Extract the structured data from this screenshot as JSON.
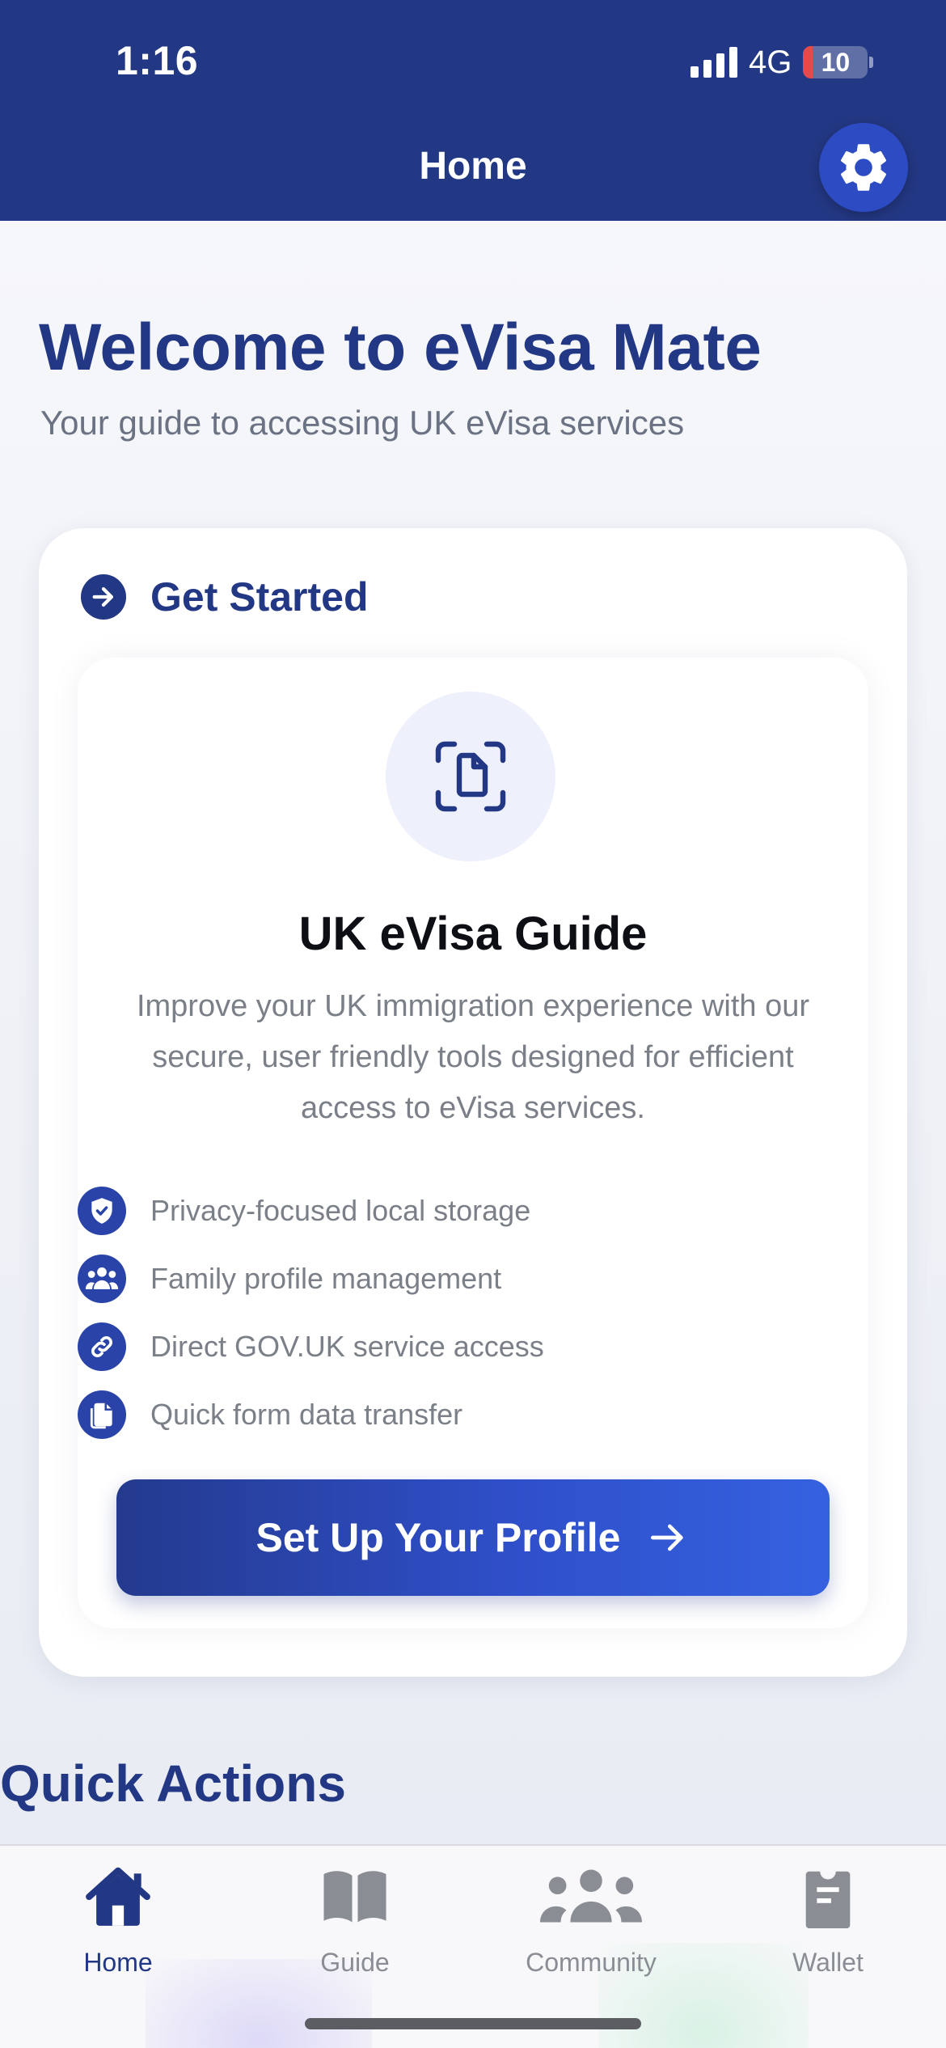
{
  "status_bar": {
    "time": "1:16",
    "network": "4G",
    "battery": "10"
  },
  "header": {
    "title": "Home",
    "settings_icon": "gear-icon"
  },
  "welcome": {
    "title": "Welcome to eVisa Mate",
    "subtitle": "Your guide to accessing UK eVisa services"
  },
  "get_started": {
    "label": "Get Started",
    "icon": "arrow-right-circle-icon",
    "card": {
      "icon": "document-scan-icon",
      "title": "UK eVisa Guide",
      "description": "Improve your UK immigration experience with our secure, user friendly tools designed for efficient access to eVisa services.",
      "features": [
        {
          "icon": "shield-check-icon",
          "label": "Privacy-focused local storage"
        },
        {
          "icon": "people-icon",
          "label": "Family profile management"
        },
        {
          "icon": "link-icon",
          "label": "Direct GOV.UK service access"
        },
        {
          "icon": "documents-icon",
          "label": "Quick form data transfer"
        }
      ],
      "cta_label": "Set Up Your Profile"
    }
  },
  "quick_actions": {
    "title": "Quick Actions"
  },
  "tabs": [
    {
      "label": "Home",
      "icon": "house-icon",
      "active": true
    },
    {
      "label": "Guide",
      "icon": "book-icon",
      "active": false
    },
    {
      "label": "Community",
      "icon": "people-icon",
      "active": false
    },
    {
      "label": "Wallet",
      "icon": "wallet-icon",
      "active": false
    }
  ],
  "colors": {
    "primary": "#233884",
    "accent": "#2d4cc4",
    "text_muted": "#7b7f88",
    "tab_inactive": "#8a8d94"
  }
}
